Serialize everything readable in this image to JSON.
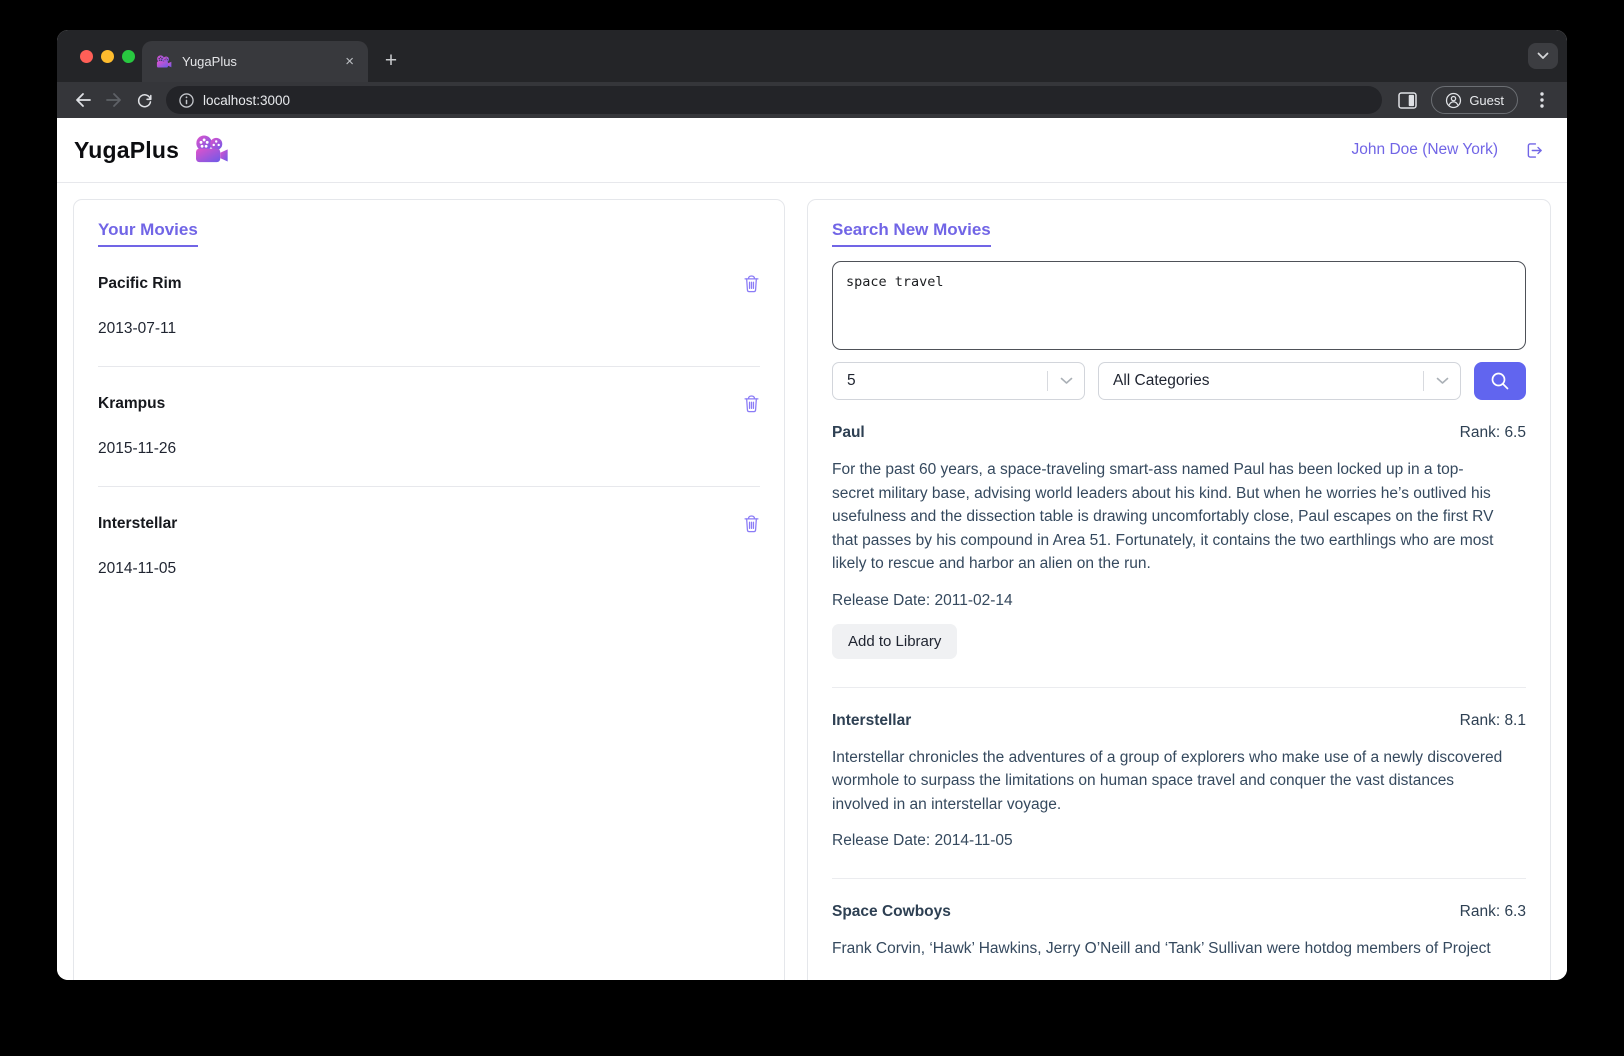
{
  "browser": {
    "tab_title": "YugaPlus",
    "url": "localhost:3000",
    "profile_label": "Guest",
    "new_tab_glyph": "+",
    "tab_close_glyph": "×"
  },
  "header": {
    "brand": "YugaPlus",
    "user": "John Doe (New York)"
  },
  "library": {
    "title": "Your Movies",
    "movies": [
      {
        "title": "Pacific Rim",
        "date": "2013-07-11"
      },
      {
        "title": "Krampus",
        "date": "2015-11-26"
      },
      {
        "title": "Interstellar",
        "date": "2014-11-05"
      }
    ]
  },
  "search": {
    "title": "Search New Movies",
    "query": "space travel",
    "limit": "5",
    "category": "All Categories",
    "results": [
      {
        "title": "Paul",
        "rank": "Rank: 6.5",
        "description": "For the past 60 years, a space-traveling smart-ass named Paul has been locked up in a top-secret military base, advising world leaders about his kind. But when he worries he’s outlived his usefulness and the dissection table is drawing uncomfortably close, Paul escapes on the first RV that passes by his compound in Area 51. Fortunately, it contains the two earthlings who are most likely to rescue and harbor an alien on the run.",
        "release": "Release Date: 2011-02-14",
        "action": "Add to Library"
      },
      {
        "title": "Interstellar",
        "rank": "Rank: 8.1",
        "description": "Interstellar chronicles the adventures of a group of explorers who make use of a newly discovered wormhole to surpass the limitations on human space travel and conquer the vast distances involved in an interstellar voyage.",
        "release": "Release Date: 2014-11-05"
      },
      {
        "title": "Space Cowboys",
        "rank": "Rank: 6.3",
        "description": "Frank Corvin, ‘Hawk’ Hawkins, Jerry O’Neill and ‘Tank’ Sullivan were hotdog members of Project"
      }
    ]
  },
  "colors": {
    "accent_purple": "#7165e6",
    "search_button_indigo": "#6165ef",
    "trash_icon_purple": "#8b7cf6",
    "result_text": "#2e4053"
  }
}
